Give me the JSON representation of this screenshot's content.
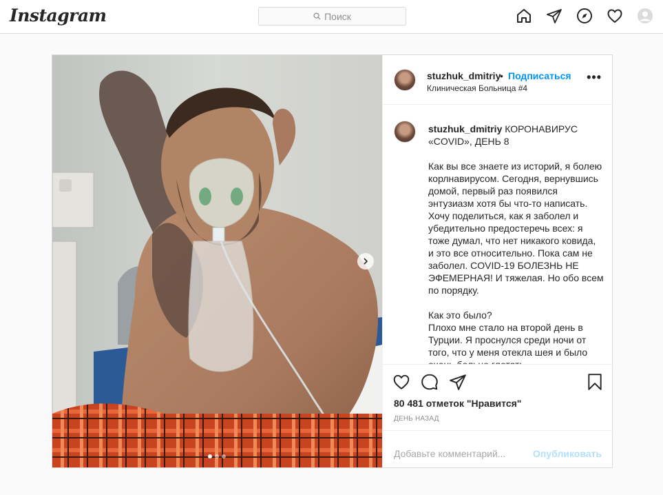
{
  "header": {
    "logo": "Instagram",
    "search_placeholder": "Поиск"
  },
  "nav_icons": [
    "home-icon",
    "direct-icon",
    "explore-icon",
    "activity-icon",
    "profile-avatar"
  ],
  "post": {
    "username": "stuzhuk_dmitriy",
    "separator": "•",
    "follow_label": "Подписаться",
    "location": "Клиническая Больница #4",
    "more_label": "•••",
    "caption_title": " КОРОНАВИРУС «COVID», ДЕНЬ 8",
    "caption_body": "Как вы все знаете из историй, я болею корлнавирусом. Сегодня, вернувшись домой, первый раз появился энтузиазм хотя бы что-то написать. Хочу поделиться, как я заболел и убедительно предостеречь всех: я тоже думал, что нет никакого ковида, и это все относительно. Пока сам не заболел. COVID-19 БОЛЕЗНЬ НЕ ЭФЕМЕРНАЯ! И тяжелая. Но обо всем по порядку.\n\nКак это было?\nПлохо мне стало на второй день в Турции. Я проснулся среди ночи от того, что у меня отекла шея и было очень больно глотать.",
    "likes": "80 481 отметок \"Нравится\"",
    "time": "ДЕНЬ НАЗАД",
    "comment_placeholder": "Добавьте комментарий...",
    "publish_label": "Опубликовать",
    "carousel": {
      "count": 3,
      "active": 0
    }
  },
  "colors": {
    "accent": "#0095f6",
    "publish_disabled": "#b2dffc",
    "border": "#dbdbdb"
  }
}
